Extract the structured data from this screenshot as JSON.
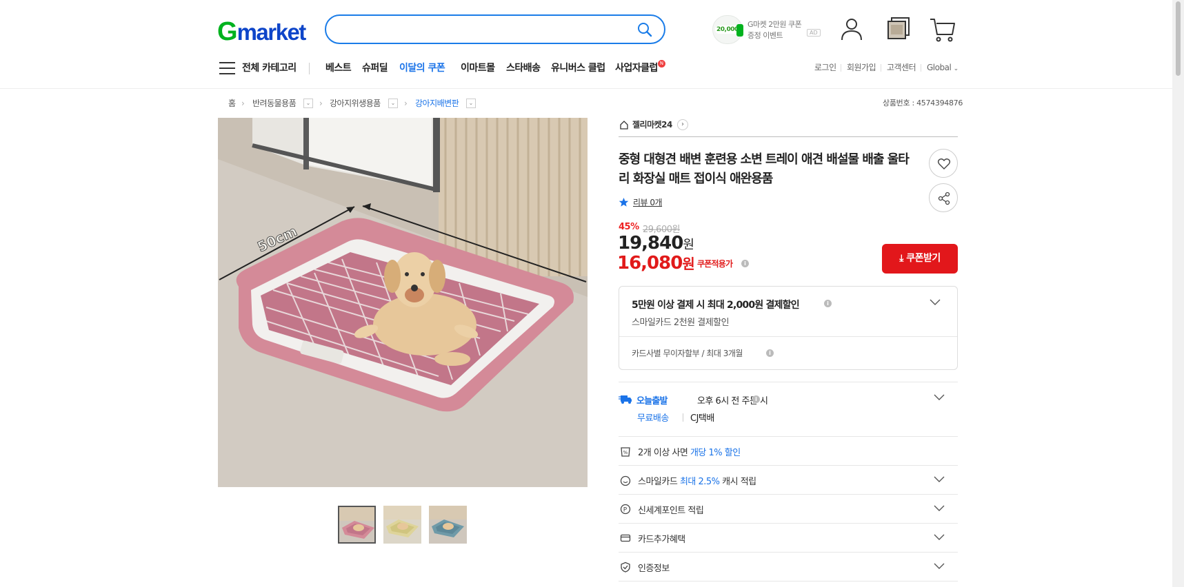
{
  "header": {
    "logo_g": "G",
    "logo_rest": "market",
    "search_placeholder": "",
    "ad": {
      "coin": "20,000",
      "line1": "G마켓 2만원 쿠폰",
      "line2": "증정 이벤트",
      "badge": "AD"
    }
  },
  "nav": {
    "all_categories": "전체 카테고리",
    "items": [
      "베스트",
      "슈퍼딜",
      "이달의 쿠폰",
      "이마트몰",
      "스타배송",
      "유니버스 클럽",
      "사업자클럽"
    ],
    "new_badge": "N",
    "util": [
      "로그인",
      "회원가입",
      "고객센터",
      "Global"
    ]
  },
  "breadcrumb": {
    "items": [
      "홈",
      "반려동물용품",
      "강아지위생용품",
      "강아지배변판"
    ],
    "product_no": "상품번호 : 4574394876"
  },
  "image": {
    "dimension_label": "50cm"
  },
  "product": {
    "shop": "젤리마켓24",
    "title": "중형 대형견 배변 훈련용 소변 트레이 애견 배설물 배출 울타리 화장실 매트 접이식 애완용품",
    "reviews": "리뷰 0개",
    "discount": "45%",
    "original_price": "29,600원",
    "price": "19,840",
    "price_unit": "원",
    "coupon_price": "16,080",
    "coupon_unit": "원",
    "coupon_label": "쿠폰적용가",
    "coupon_button": "쿠폰받기"
  },
  "payment": {
    "title": "5만원 이상 결제 시 최대 2,000원 결제할인",
    "sub": "스마일카드 2천원 결제할인",
    "installment": "카드사별 무이자할부 / 최대 3개월"
  },
  "delivery": {
    "badge": "오늘출발",
    "cutoff": "오후 6시 전 주문 시",
    "free": "무료배송",
    "carrier": "CJ택배"
  },
  "benefits": {
    "multi_pre": "2개 이상 사면 ",
    "multi_hl": "개당 1% 할인",
    "smile_pre": "스마일카드 ",
    "smile_hl": "최대 2.5%",
    "smile_post": " 캐시 적립",
    "shinsegae": "신세계포인트 적립",
    "card": "카드추가혜택",
    "cert": "인증정보"
  },
  "colors": {
    "accent_blue": "#1a73e8",
    "sale_red": "#e11a1a",
    "brand_green": "#00b21e"
  }
}
